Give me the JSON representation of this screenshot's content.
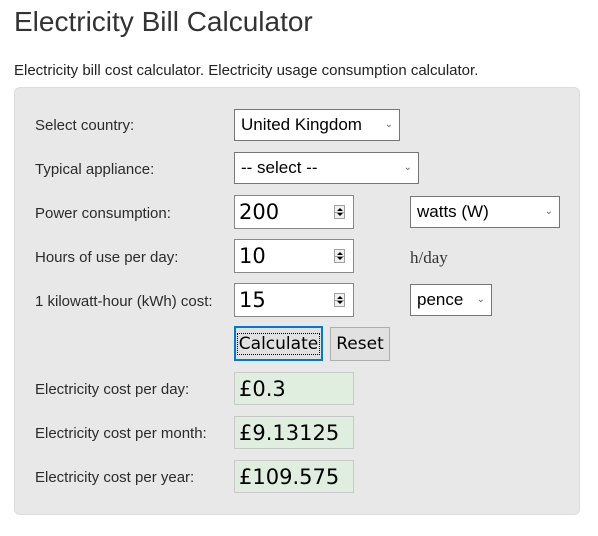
{
  "page": {
    "title": "Electricity Bill Calculator",
    "subtitle": "Electricity bill cost calculator. Electricity usage consumption calculator."
  },
  "form": {
    "country": {
      "label": "Select country:",
      "value": "United Kingdom",
      "icon": "chevron-down-icon"
    },
    "appliance": {
      "label": "Typical appliance:",
      "value": "-- select --",
      "icon": "chevron-down-icon"
    },
    "power": {
      "label": "Power consumption:",
      "value": "200",
      "unit": "watts (W)"
    },
    "hours": {
      "label": "Hours of use per day:",
      "value": "10",
      "unit": "h/day"
    },
    "cost": {
      "label": "1 kilowatt-hour (kWh) cost:",
      "value": "15",
      "unit": "pence"
    },
    "buttons": {
      "calculate": "Calculate",
      "reset": "Reset"
    }
  },
  "results": [
    {
      "label": "Electricity cost per day:",
      "value": "£0.3"
    },
    {
      "label": "Electricity cost per month:",
      "value": "£9.13125"
    },
    {
      "label": "Electricity cost per year:",
      "value": "£109.575"
    }
  ],
  "colors": {
    "panel_bg": "#e8e8e8",
    "result_bg": "#dfeedf",
    "focus_border": "#0078d7"
  }
}
